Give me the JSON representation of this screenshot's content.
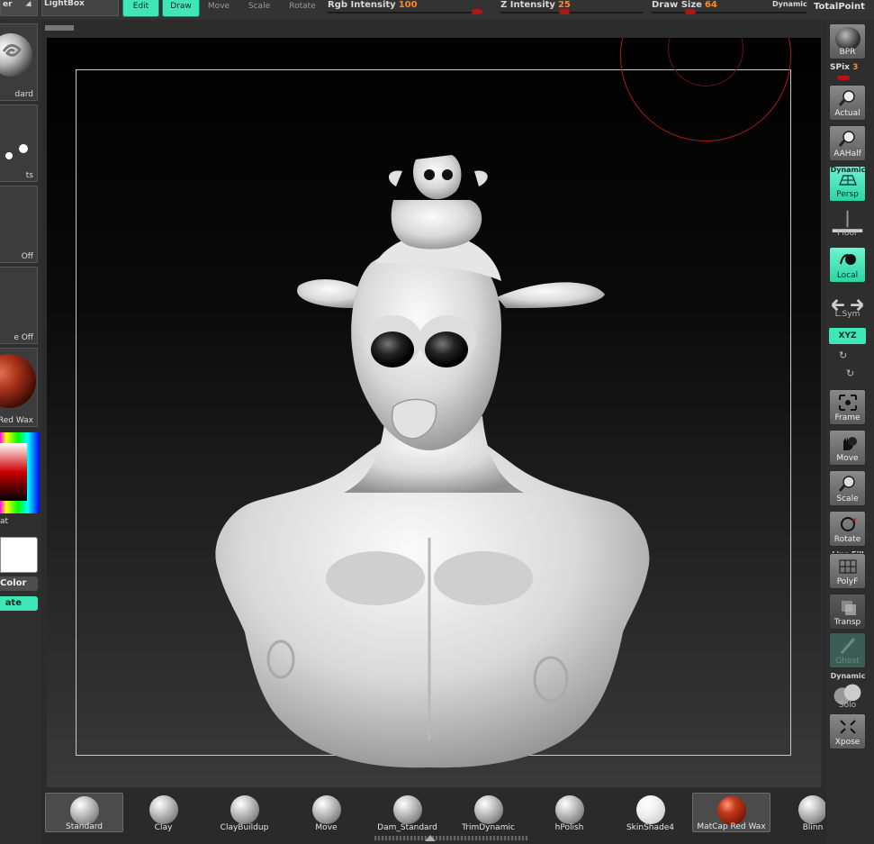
{
  "topbar": {
    "dropdown_label": "er",
    "lightbox_label": "LightBox",
    "edit_label": "Edit",
    "draw_label": "Draw",
    "move_label": "Move",
    "scale_label": "Scale",
    "rotate_label": "Rotate",
    "rgb_intensity": {
      "label": "Rgb Intensity",
      "value": "100"
    },
    "z_intensity": {
      "label": "Z Intensity",
      "value": "25"
    },
    "draw_size": {
      "label": "Draw Size",
      "value": "64",
      "dynamic_label": "Dynamic"
    },
    "totalpoints_label": "TotalPoint"
  },
  "leftpanel": {
    "brush_label": "dard",
    "stroke_label": "ts",
    "alpha_label": "Off",
    "texture_label": "e Off",
    "material_label": "Red Wax",
    "gradient_label": "at",
    "switch_color_label": "Color",
    "alternate_label": "ate"
  },
  "rightpanel": {
    "bpr_label": "BPR",
    "spix_label": "SPix",
    "spix_value": "3",
    "actual_label": "Actual",
    "aahalf_label": "AAHalf",
    "persp_over_label": "Dynamic",
    "persp_label": "Persp",
    "floor_label": "Floor",
    "local_label": "Local",
    "lsym_label": "L.Sym",
    "xyz_label": "XYZ",
    "frame_label": "Frame",
    "move_label": "Move",
    "scale_label": "Scale",
    "rotate_label": "Rotate",
    "polyf_over_label": "Line Fill",
    "polyf_label": "PolyF",
    "transp_label": "Transp",
    "ghost_label": "Ghost",
    "solo_over_label": "Dynamic",
    "solo_label": "Solo",
    "xpose_label": "Xpose"
  },
  "brushes": [
    {
      "label": "Standard",
      "selected": true,
      "material": "grey"
    },
    {
      "label": "Clay",
      "selected": false,
      "material": "grey"
    },
    {
      "label": "ClayBuildup",
      "selected": false,
      "material": "grey"
    },
    {
      "label": "Move",
      "selected": false,
      "material": "grey"
    },
    {
      "label": "Dam_Standard",
      "selected": false,
      "material": "grey"
    },
    {
      "label": "TrimDynamic",
      "selected": false,
      "material": "grey"
    },
    {
      "label": "hPolish",
      "selected": false,
      "material": "grey"
    },
    {
      "label": "SkinShade4",
      "selected": false,
      "material": "white"
    },
    {
      "label": "MatCap Red Wax",
      "selected": true,
      "material": "red"
    },
    {
      "label": "Blinn",
      "selected": false,
      "material": "grey"
    }
  ],
  "colors": {
    "accent": "#3ee6b8",
    "slider_value": "#ff8a1c",
    "brush_ring": "#b01818",
    "panel": "#2b2b2b"
  }
}
